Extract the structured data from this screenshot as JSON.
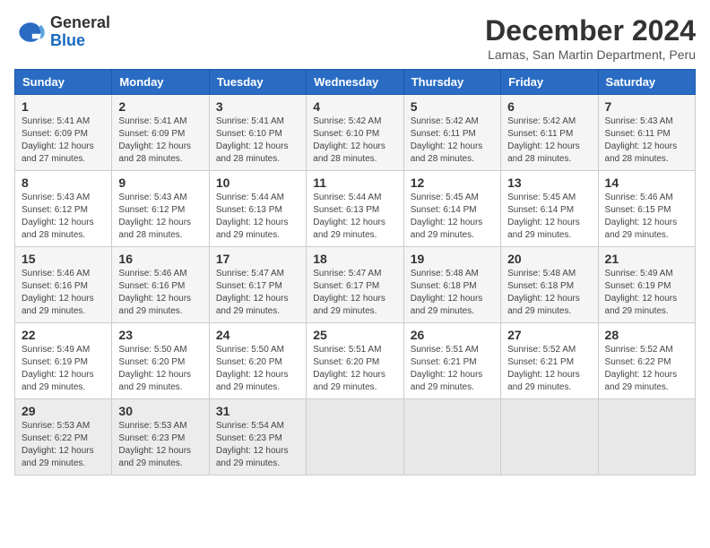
{
  "logo": {
    "line1": "General",
    "line2": "Blue"
  },
  "header": {
    "month_year": "December 2024",
    "location": "Lamas, San Martin Department, Peru"
  },
  "days_of_week": [
    "Sunday",
    "Monday",
    "Tuesday",
    "Wednesday",
    "Thursday",
    "Friday",
    "Saturday"
  ],
  "weeks": [
    [
      {
        "day": "1",
        "sunrise": "5:41 AM",
        "sunset": "6:09 PM",
        "daylight": "12 hours and 27 minutes."
      },
      {
        "day": "2",
        "sunrise": "5:41 AM",
        "sunset": "6:09 PM",
        "daylight": "12 hours and 28 minutes."
      },
      {
        "day": "3",
        "sunrise": "5:41 AM",
        "sunset": "6:10 PM",
        "daylight": "12 hours and 28 minutes."
      },
      {
        "day": "4",
        "sunrise": "5:42 AM",
        "sunset": "6:10 PM",
        "daylight": "12 hours and 28 minutes."
      },
      {
        "day": "5",
        "sunrise": "5:42 AM",
        "sunset": "6:11 PM",
        "daylight": "12 hours and 28 minutes."
      },
      {
        "day": "6",
        "sunrise": "5:42 AM",
        "sunset": "6:11 PM",
        "daylight": "12 hours and 28 minutes."
      },
      {
        "day": "7",
        "sunrise": "5:43 AM",
        "sunset": "6:11 PM",
        "daylight": "12 hours and 28 minutes."
      }
    ],
    [
      {
        "day": "8",
        "sunrise": "5:43 AM",
        "sunset": "6:12 PM",
        "daylight": "12 hours and 28 minutes."
      },
      {
        "day": "9",
        "sunrise": "5:43 AM",
        "sunset": "6:12 PM",
        "daylight": "12 hours and 28 minutes."
      },
      {
        "day": "10",
        "sunrise": "5:44 AM",
        "sunset": "6:13 PM",
        "daylight": "12 hours and 29 minutes."
      },
      {
        "day": "11",
        "sunrise": "5:44 AM",
        "sunset": "6:13 PM",
        "daylight": "12 hours and 29 minutes."
      },
      {
        "day": "12",
        "sunrise": "5:45 AM",
        "sunset": "6:14 PM",
        "daylight": "12 hours and 29 minutes."
      },
      {
        "day": "13",
        "sunrise": "5:45 AM",
        "sunset": "6:14 PM",
        "daylight": "12 hours and 29 minutes."
      },
      {
        "day": "14",
        "sunrise": "5:46 AM",
        "sunset": "6:15 PM",
        "daylight": "12 hours and 29 minutes."
      }
    ],
    [
      {
        "day": "15",
        "sunrise": "5:46 AM",
        "sunset": "6:16 PM",
        "daylight": "12 hours and 29 minutes."
      },
      {
        "day": "16",
        "sunrise": "5:46 AM",
        "sunset": "6:16 PM",
        "daylight": "12 hours and 29 minutes."
      },
      {
        "day": "17",
        "sunrise": "5:47 AM",
        "sunset": "6:17 PM",
        "daylight": "12 hours and 29 minutes."
      },
      {
        "day": "18",
        "sunrise": "5:47 AM",
        "sunset": "6:17 PM",
        "daylight": "12 hours and 29 minutes."
      },
      {
        "day": "19",
        "sunrise": "5:48 AM",
        "sunset": "6:18 PM",
        "daylight": "12 hours and 29 minutes."
      },
      {
        "day": "20",
        "sunrise": "5:48 AM",
        "sunset": "6:18 PM",
        "daylight": "12 hours and 29 minutes."
      },
      {
        "day": "21",
        "sunrise": "5:49 AM",
        "sunset": "6:19 PM",
        "daylight": "12 hours and 29 minutes."
      }
    ],
    [
      {
        "day": "22",
        "sunrise": "5:49 AM",
        "sunset": "6:19 PM",
        "daylight": "12 hours and 29 minutes."
      },
      {
        "day": "23",
        "sunrise": "5:50 AM",
        "sunset": "6:20 PM",
        "daylight": "12 hours and 29 minutes."
      },
      {
        "day": "24",
        "sunrise": "5:50 AM",
        "sunset": "6:20 PM",
        "daylight": "12 hours and 29 minutes."
      },
      {
        "day": "25",
        "sunrise": "5:51 AM",
        "sunset": "6:20 PM",
        "daylight": "12 hours and 29 minutes."
      },
      {
        "day": "26",
        "sunrise": "5:51 AM",
        "sunset": "6:21 PM",
        "daylight": "12 hours and 29 minutes."
      },
      {
        "day": "27",
        "sunrise": "5:52 AM",
        "sunset": "6:21 PM",
        "daylight": "12 hours and 29 minutes."
      },
      {
        "day": "28",
        "sunrise": "5:52 AM",
        "sunset": "6:22 PM",
        "daylight": "12 hours and 29 minutes."
      }
    ],
    [
      {
        "day": "29",
        "sunrise": "5:53 AM",
        "sunset": "6:22 PM",
        "daylight": "12 hours and 29 minutes."
      },
      {
        "day": "30",
        "sunrise": "5:53 AM",
        "sunset": "6:23 PM",
        "daylight": "12 hours and 29 minutes."
      },
      {
        "day": "31",
        "sunrise": "5:54 AM",
        "sunset": "6:23 PM",
        "daylight": "12 hours and 29 minutes."
      },
      null,
      null,
      null,
      null
    ]
  ],
  "labels": {
    "sunrise": "Sunrise:",
    "sunset": "Sunset:",
    "daylight": "Daylight:"
  }
}
